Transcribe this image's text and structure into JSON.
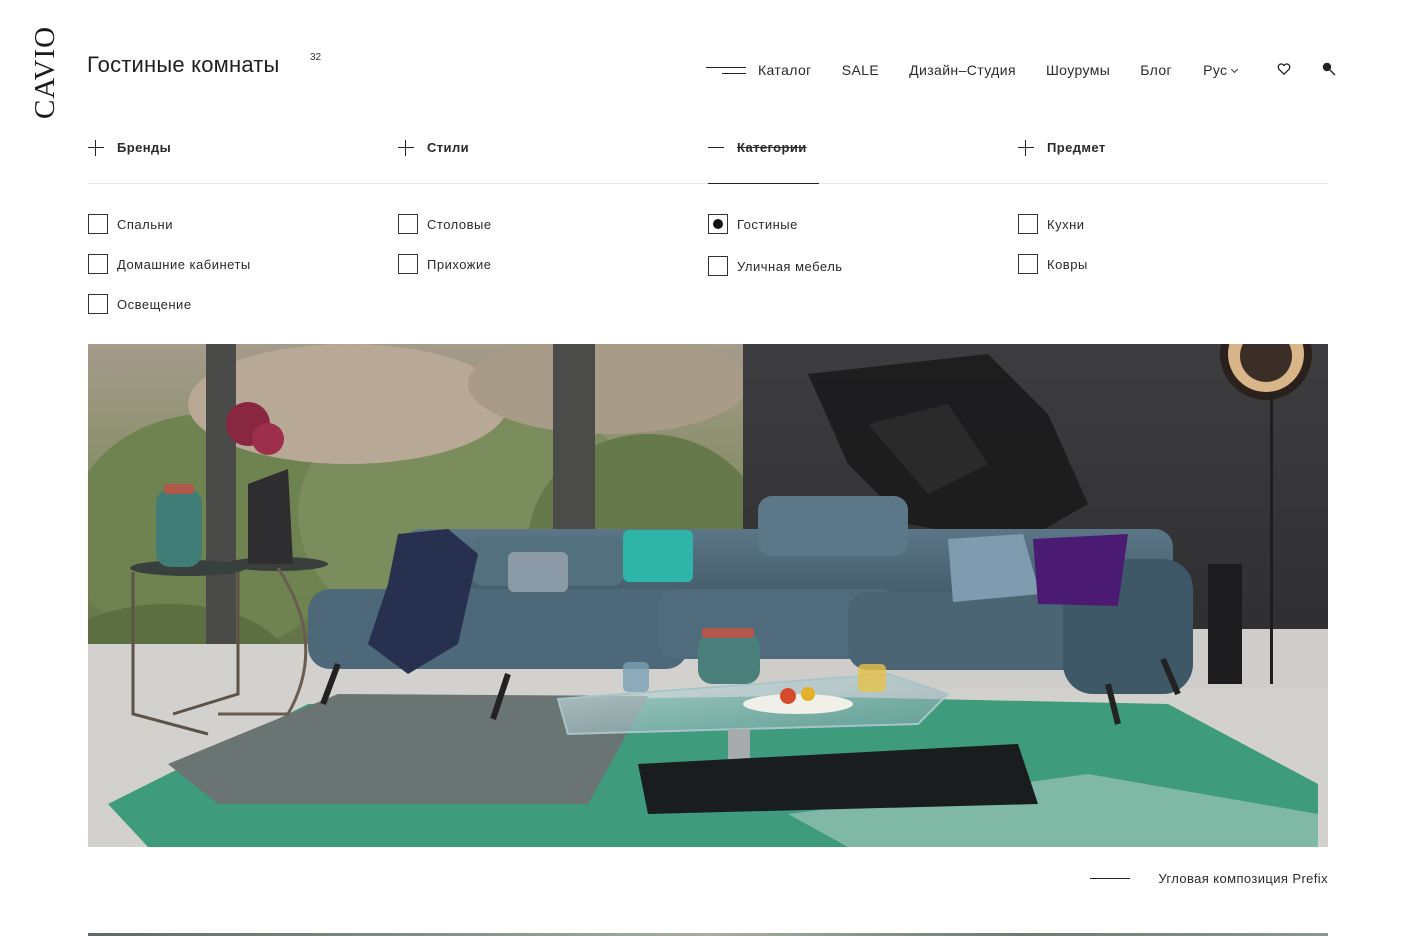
{
  "brand": {
    "logo_text": "CAVIO"
  },
  "header": {
    "title": "Гостиные комнаты",
    "count": "32",
    "nav": {
      "catalog": "Каталог",
      "sale": "SALE",
      "design_studio": "Дизайн–Студия",
      "showrooms": "Шоурумы",
      "blog": "Блог",
      "language": "Рус"
    },
    "icons": [
      "menu-icon",
      "chevron-down-icon",
      "heart-icon",
      "search-icon"
    ]
  },
  "filters": {
    "tabs": [
      {
        "label": "Бренды",
        "state": "collapsed"
      },
      {
        "label": "Стили",
        "state": "collapsed"
      },
      {
        "label": "Категории",
        "state": "expanded"
      },
      {
        "label": "Предмет",
        "state": "collapsed"
      }
    ],
    "options": [
      {
        "label": "Спальни",
        "checked": false
      },
      {
        "label": "Домашние кабинеты",
        "checked": false
      },
      {
        "label": "Освещение",
        "checked": false
      },
      {
        "label": "Столовые",
        "checked": false
      },
      {
        "label": "Прихожие",
        "checked": false
      },
      {
        "label": "Гостиные",
        "checked": true
      },
      {
        "label": "Уличная мебель",
        "checked": false
      },
      {
        "label": "Кухни",
        "checked": false
      },
      {
        "label": "Ковры",
        "checked": false
      }
    ]
  },
  "hero": {
    "caption": "Угловая композиция Prefix",
    "colors": {
      "sofa": "#4e6777",
      "rug": "#3d9a7b",
      "wall": "#3a3a3c",
      "floor": "#d8d6d3",
      "greenery": "#6b7f4a"
    }
  }
}
